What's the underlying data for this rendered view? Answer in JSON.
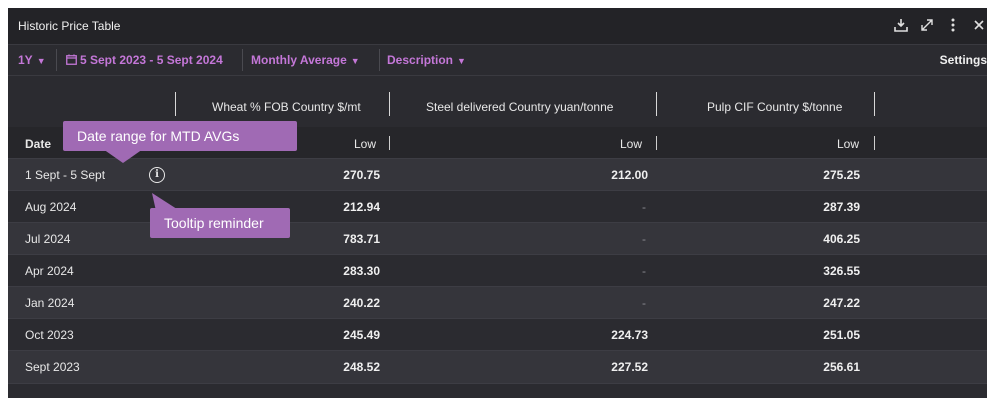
{
  "window": {
    "title": "Historic Price Table",
    "icons": [
      "download-icon",
      "expand-icon",
      "kebab-menu-icon",
      "close-icon"
    ]
  },
  "toolbar": {
    "period": "1Y",
    "date_range": "5 Sept 2023 - 5 Sept 2024",
    "aggregation": "Monthly Average",
    "description": "Description",
    "settings": "Settings"
  },
  "table": {
    "date_header": "Date",
    "columns": [
      {
        "name": "Wheat % FOB Country $/mt",
        "sub": "Low"
      },
      {
        "name": "Steel delivered Country yuan/tonne",
        "sub": "Low"
      },
      {
        "name": "Pulp CIF Country $/tonne",
        "sub": "Low"
      }
    ],
    "rows": [
      {
        "date": "1 Sept - 5 Sept",
        "wheat": "270.75",
        "steel": "212.00",
        "pulp": "275.25"
      },
      {
        "date": "Aug 2024",
        "wheat": "212.94",
        "steel": "-",
        "pulp": "287.39"
      },
      {
        "date": "Jul 2024",
        "wheat": "783.71",
        "steel": "-",
        "pulp": "406.25"
      },
      {
        "date": "Apr 2024",
        "wheat": "283.30",
        "steel": "-",
        "pulp": "326.55"
      },
      {
        "date": "Jan 2024",
        "wheat": "240.22",
        "steel": "-",
        "pulp": "247.22"
      },
      {
        "date": "Oct 2023",
        "wheat": "245.49",
        "steel": "224.73",
        "pulp": "251.05"
      },
      {
        "date": "Sept 2023",
        "wheat": "248.52",
        "steel": "227.52",
        "pulp": "256.61"
      }
    ]
  },
  "annotations": {
    "date_range_callout": "Date range for MTD AVGs",
    "tooltip_callout": "Tooltip reminder"
  },
  "colors": {
    "accent": "#c477d8",
    "callout": "#a06ab4",
    "panel": "#2b2b30"
  }
}
